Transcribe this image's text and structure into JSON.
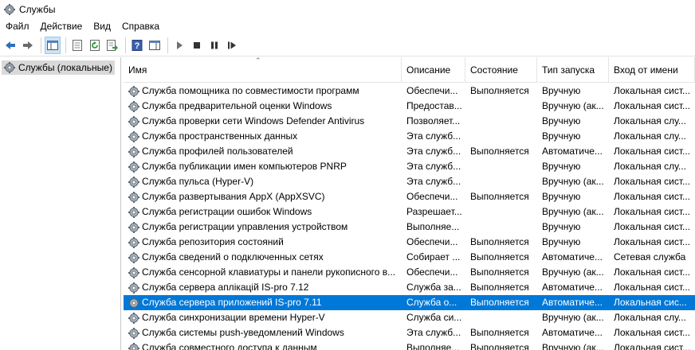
{
  "window": {
    "title": "Службы"
  },
  "menu": [
    "Файл",
    "Действие",
    "Вид",
    "Справка"
  ],
  "tree": {
    "label": "Службы (локальные)"
  },
  "columns": {
    "name": "Имя",
    "description": "Описание",
    "state": "Состояние",
    "startup": "Тип запуска",
    "logon": "Вход от имени"
  },
  "rows": [
    {
      "name": "Служба помощника по совместимости программ",
      "description": "Обеспечи...",
      "state": "Выполняется",
      "startup": "Вручную",
      "logon": "Локальная сист..."
    },
    {
      "name": "Служба предварительной оценки Windows",
      "description": "Предостав...",
      "state": "",
      "startup": "Вручную (ак...",
      "logon": "Локальная сист..."
    },
    {
      "name": "Служба проверки сети Windows Defender Antivirus",
      "description": "Позволяет...",
      "state": "",
      "startup": "Вручную",
      "logon": "Локальная слу..."
    },
    {
      "name": "Служба пространственных данных",
      "description": "Эта служб...",
      "state": "",
      "startup": "Вручную",
      "logon": "Локальная слу..."
    },
    {
      "name": "Служба профилей пользователей",
      "description": "Эта служб...",
      "state": "Выполняется",
      "startup": "Автоматиче...",
      "logon": "Локальная сист..."
    },
    {
      "name": "Служба публикации имен компьютеров PNRP",
      "description": "Эта служб...",
      "state": "",
      "startup": "Вручную",
      "logon": "Локальная слу..."
    },
    {
      "name": "Служба пульса (Hyper-V)",
      "description": "Эта служб...",
      "state": "",
      "startup": "Вручную (ак...",
      "logon": "Локальная сист..."
    },
    {
      "name": "Служба развертывания AppX (AppXSVC)",
      "description": "Обеспечи...",
      "state": "Выполняется",
      "startup": "Вручную",
      "logon": "Локальная сист..."
    },
    {
      "name": "Служба регистрации ошибок Windows",
      "description": "Разрешает...",
      "state": "",
      "startup": "Вручную (ак...",
      "logon": "Локальная сист..."
    },
    {
      "name": "Служба регистрации управления устройством",
      "description": "Выполняе...",
      "state": "",
      "startup": "Вручную",
      "logon": "Локальная сист..."
    },
    {
      "name": "Служба репозитория состояний",
      "description": "Обеспечи...",
      "state": "Выполняется",
      "startup": "Вручную",
      "logon": "Локальная сист..."
    },
    {
      "name": "Служба сведений о подключенных сетях",
      "description": "Собирает ...",
      "state": "Выполняется",
      "startup": "Автоматиче...",
      "logon": "Сетевая служба"
    },
    {
      "name": "Служба сенсорной клавиатуры и панели рукописного в...",
      "description": "Обеспечи...",
      "state": "Выполняется",
      "startup": "Вручную (ак...",
      "logon": "Локальная сист..."
    },
    {
      "name": "Служба сервера аплікацій IS-pro 7.12",
      "description": "Служба за...",
      "state": "Выполняется",
      "startup": "Автоматиче...",
      "logon": "Локальная сист..."
    },
    {
      "name": "Служба сервера приложений IS-pro 7.11",
      "description": "Служба о...",
      "state": "Выполняется",
      "startup": "Автоматиче...",
      "logon": "Локальная сис...",
      "selected": true
    },
    {
      "name": "Служба синхронизации времени Hyper-V",
      "description": "Служба си...",
      "state": "",
      "startup": "Вручную (ак...",
      "logon": "Локальная слу..."
    },
    {
      "name": "Служба системы push-уведомлений Windows",
      "description": "Эта служб...",
      "state": "Выполняется",
      "startup": "Автоматиче...",
      "logon": "Локальная сист..."
    },
    {
      "name": "Служба совместного доступа к данным",
      "description": "Выполняе...",
      "state": "Выполняется",
      "startup": "Вручную (ак...",
      "logon": "Локальная сист..."
    }
  ],
  "icons": {
    "app": "services-gear-icon",
    "row": "service-gear-icon",
    "toolbar": [
      "back-arrow-icon",
      "forward-arrow-icon",
      "console-tree-icon",
      "properties-icon",
      "refresh-icon",
      "export-list-icon",
      "help-icon",
      "show-hide-action-pane-icon",
      "start-service-icon",
      "stop-service-icon",
      "pause-service-icon",
      "restart-service-icon"
    ]
  },
  "colors": {
    "selection": "#0078d7",
    "selection_text": "#ffffff"
  }
}
